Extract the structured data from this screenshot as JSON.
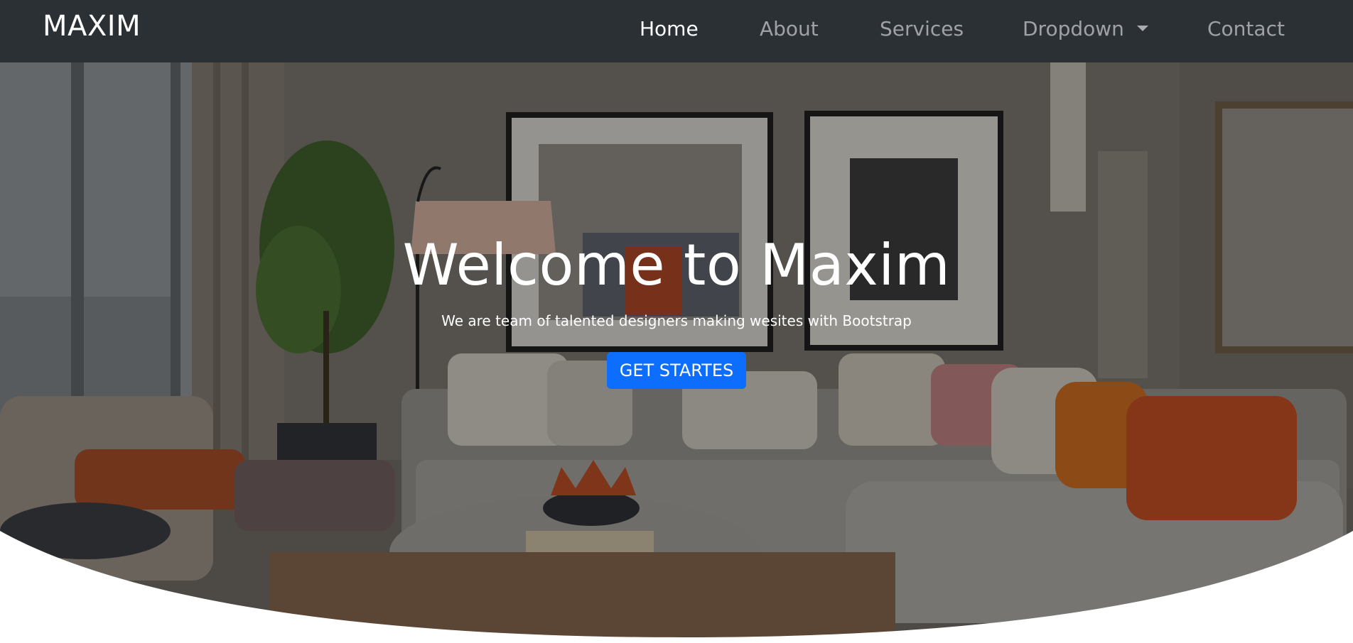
{
  "navbar": {
    "brand": "MAXIM",
    "links": [
      {
        "label": "Home"
      },
      {
        "label": "About"
      },
      {
        "label": "Services"
      },
      {
        "label": "Dropdown"
      },
      {
        "label": "Contact"
      }
    ]
  },
  "hero": {
    "title": "Welcome to Maxim",
    "subtitle": "We are team of talented designers making wesites with Bootstrap",
    "cta_label": "GET STARTES"
  },
  "colors": {
    "navbar_bg": "#2b3035",
    "nav_active": "#ffffff",
    "nav_inactive": "rgba(255,255,255,0.55)",
    "cta_bg": "#0d6efd"
  },
  "icons": {
    "dropdown": "caret-down-icon"
  }
}
